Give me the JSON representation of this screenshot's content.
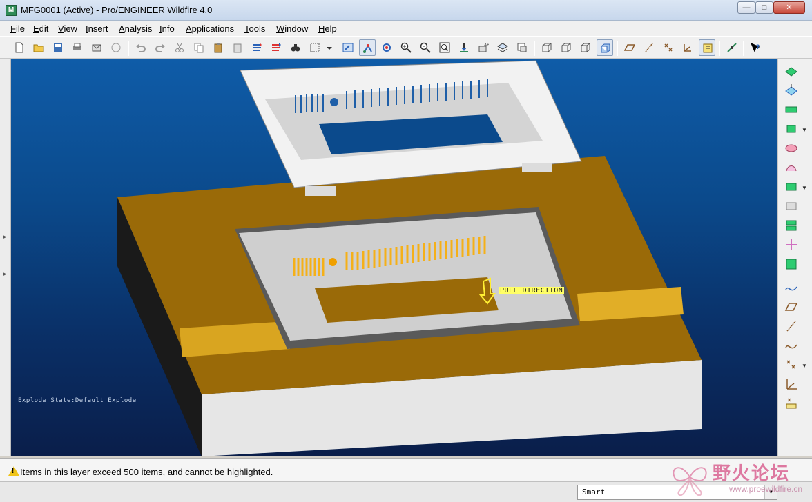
{
  "window": {
    "title": "MFG0001 (Active) - Pro/ENGINEER Wildfire 4.0",
    "icon_letter": "M"
  },
  "menu": [
    {
      "label": "File",
      "accel": "F"
    },
    {
      "label": "Edit",
      "accel": "E"
    },
    {
      "label": "View",
      "accel": "V"
    },
    {
      "label": "Insert",
      "accel": "I"
    },
    {
      "label": "Analysis",
      "accel": "A"
    },
    {
      "label": "Info",
      "accel": "I"
    },
    {
      "label": "Applications",
      "accel": "A"
    },
    {
      "label": "Tools",
      "accel": "T"
    },
    {
      "label": "Window",
      "accel": "W"
    },
    {
      "label": "Help",
      "accel": "H"
    }
  ],
  "viewport": {
    "explode_state": "Explode State:Default Explode",
    "pull_direction": "PULL DIRECTION"
  },
  "message": {
    "text": "Items in this layer exceed 500 items, and cannot be highlighted."
  },
  "status": {
    "filter_value": "Smart"
  },
  "watermark": {
    "name": "野火论坛",
    "url": "www.proewildfire.cn"
  },
  "colors": {
    "viewport_top": "#0f5ca8",
    "viewport_bottom": "#0a1e4a",
    "mold_gold": "#9a6a08",
    "part_white": "#e8e8e8"
  }
}
